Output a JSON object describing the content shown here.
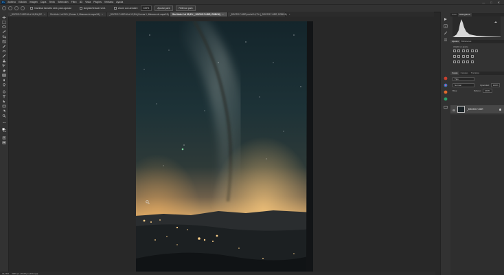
{
  "app": {
    "logo_text": "Ps"
  },
  "menu": {
    "items": [
      "Archivo",
      "Edición",
      "Imagen",
      "Capa",
      "Texto",
      "Selección",
      "Filtro",
      "3D",
      "Vista",
      "Plugins",
      "Ventana",
      "Ayuda"
    ],
    "window_controls": [
      "—",
      "□",
      "✕"
    ]
  },
  "options": {
    "resize_windows_label": "Cambiar tamaño vent. para ajustar",
    "zoom_all_label": "Ampliar/reducir vent.",
    "scrubby_zoom_label": "Zoom con arrastre",
    "zoom_value": "100%",
    "fit_screen_label": "Ajustar pant.",
    "fill_screen_label": "Rellenar pant."
  },
  "tabs": [
    {
      "label": "_DSC2217-HDR.tif al 16,5% (RGB/16*)",
      "active": false
    },
    {
      "label": "Sin título-1 al 51% (Curvas 1, Máscara de capa/16)",
      "active": false
    },
    {
      "label": "_DSC2217-HDR.tif al 12,5% (Curvas 1, Máscara de capa/16)",
      "active": false
    },
    {
      "label": "Sin título-2 al 32,8% (_DSC2217-HDR, RGB/16)",
      "active": true
    },
    {
      "label": "_DSC2217-HDR.psd al 16,7% (_DSC2217-HDR, RGB/16)",
      "active": false
    }
  ],
  "status": {
    "zoom": "32,76%",
    "doc_size": "5185 px x 8128 px (300 ppp)"
  },
  "panels": {
    "top_tabs": [
      "Color",
      "Histograma"
    ],
    "adjust_tabs": [
      "Ajustes",
      "Bibliotecas"
    ],
    "adjust_title": "Añadir un ajuste",
    "layers_tabs": [
      "Capas",
      "Canales",
      "Trazados"
    ],
    "kind_filter": "Tipo",
    "blend_mode": "Normal",
    "opacity_label": "Opacidad:",
    "opacity_value": "100%",
    "lock_label": "Bloq:",
    "fill_label": "Relleno:",
    "fill_value": "100%",
    "layer_name": "_DSC2217-HDR"
  }
}
